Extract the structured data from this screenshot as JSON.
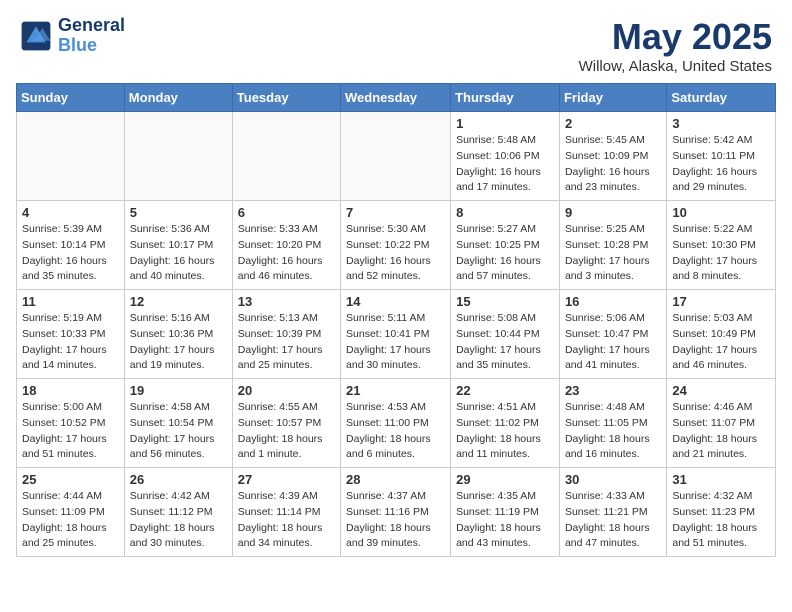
{
  "header": {
    "logo_line1": "General",
    "logo_line2": "Blue",
    "month_title": "May 2025",
    "location": "Willow, Alaska, United States"
  },
  "days_of_week": [
    "Sunday",
    "Monday",
    "Tuesday",
    "Wednesday",
    "Thursday",
    "Friday",
    "Saturday"
  ],
  "weeks": [
    [
      {
        "day": "",
        "empty": true
      },
      {
        "day": "",
        "empty": true
      },
      {
        "day": "",
        "empty": true
      },
      {
        "day": "",
        "empty": true
      },
      {
        "day": "1",
        "info": "Sunrise: 5:48 AM\nSunset: 10:06 PM\nDaylight: 16 hours\nand 17 minutes."
      },
      {
        "day": "2",
        "info": "Sunrise: 5:45 AM\nSunset: 10:09 PM\nDaylight: 16 hours\nand 23 minutes."
      },
      {
        "day": "3",
        "info": "Sunrise: 5:42 AM\nSunset: 10:11 PM\nDaylight: 16 hours\nand 29 minutes."
      }
    ],
    [
      {
        "day": "4",
        "info": "Sunrise: 5:39 AM\nSunset: 10:14 PM\nDaylight: 16 hours\nand 35 minutes."
      },
      {
        "day": "5",
        "info": "Sunrise: 5:36 AM\nSunset: 10:17 PM\nDaylight: 16 hours\nand 40 minutes."
      },
      {
        "day": "6",
        "info": "Sunrise: 5:33 AM\nSunset: 10:20 PM\nDaylight: 16 hours\nand 46 minutes."
      },
      {
        "day": "7",
        "info": "Sunrise: 5:30 AM\nSunset: 10:22 PM\nDaylight: 16 hours\nand 52 minutes."
      },
      {
        "day": "8",
        "info": "Sunrise: 5:27 AM\nSunset: 10:25 PM\nDaylight: 16 hours\nand 57 minutes."
      },
      {
        "day": "9",
        "info": "Sunrise: 5:25 AM\nSunset: 10:28 PM\nDaylight: 17 hours\nand 3 minutes."
      },
      {
        "day": "10",
        "info": "Sunrise: 5:22 AM\nSunset: 10:30 PM\nDaylight: 17 hours\nand 8 minutes."
      }
    ],
    [
      {
        "day": "11",
        "info": "Sunrise: 5:19 AM\nSunset: 10:33 PM\nDaylight: 17 hours\nand 14 minutes."
      },
      {
        "day": "12",
        "info": "Sunrise: 5:16 AM\nSunset: 10:36 PM\nDaylight: 17 hours\nand 19 minutes."
      },
      {
        "day": "13",
        "info": "Sunrise: 5:13 AM\nSunset: 10:39 PM\nDaylight: 17 hours\nand 25 minutes."
      },
      {
        "day": "14",
        "info": "Sunrise: 5:11 AM\nSunset: 10:41 PM\nDaylight: 17 hours\nand 30 minutes."
      },
      {
        "day": "15",
        "info": "Sunrise: 5:08 AM\nSunset: 10:44 PM\nDaylight: 17 hours\nand 35 minutes."
      },
      {
        "day": "16",
        "info": "Sunrise: 5:06 AM\nSunset: 10:47 PM\nDaylight: 17 hours\nand 41 minutes."
      },
      {
        "day": "17",
        "info": "Sunrise: 5:03 AM\nSunset: 10:49 PM\nDaylight: 17 hours\nand 46 minutes."
      }
    ],
    [
      {
        "day": "18",
        "info": "Sunrise: 5:00 AM\nSunset: 10:52 PM\nDaylight: 17 hours\nand 51 minutes."
      },
      {
        "day": "19",
        "info": "Sunrise: 4:58 AM\nSunset: 10:54 PM\nDaylight: 17 hours\nand 56 minutes."
      },
      {
        "day": "20",
        "info": "Sunrise: 4:55 AM\nSunset: 10:57 PM\nDaylight: 18 hours\nand 1 minute."
      },
      {
        "day": "21",
        "info": "Sunrise: 4:53 AM\nSunset: 11:00 PM\nDaylight: 18 hours\nand 6 minutes."
      },
      {
        "day": "22",
        "info": "Sunrise: 4:51 AM\nSunset: 11:02 PM\nDaylight: 18 hours\nand 11 minutes."
      },
      {
        "day": "23",
        "info": "Sunrise: 4:48 AM\nSunset: 11:05 PM\nDaylight: 18 hours\nand 16 minutes."
      },
      {
        "day": "24",
        "info": "Sunrise: 4:46 AM\nSunset: 11:07 PM\nDaylight: 18 hours\nand 21 minutes."
      }
    ],
    [
      {
        "day": "25",
        "info": "Sunrise: 4:44 AM\nSunset: 11:09 PM\nDaylight: 18 hours\nand 25 minutes."
      },
      {
        "day": "26",
        "info": "Sunrise: 4:42 AM\nSunset: 11:12 PM\nDaylight: 18 hours\nand 30 minutes."
      },
      {
        "day": "27",
        "info": "Sunrise: 4:39 AM\nSunset: 11:14 PM\nDaylight: 18 hours\nand 34 minutes."
      },
      {
        "day": "28",
        "info": "Sunrise: 4:37 AM\nSunset: 11:16 PM\nDaylight: 18 hours\nand 39 minutes."
      },
      {
        "day": "29",
        "info": "Sunrise: 4:35 AM\nSunset: 11:19 PM\nDaylight: 18 hours\nand 43 minutes."
      },
      {
        "day": "30",
        "info": "Sunrise: 4:33 AM\nSunset: 11:21 PM\nDaylight: 18 hours\nand 47 minutes."
      },
      {
        "day": "31",
        "info": "Sunrise: 4:32 AM\nSunset: 11:23 PM\nDaylight: 18 hours\nand 51 minutes."
      }
    ]
  ]
}
